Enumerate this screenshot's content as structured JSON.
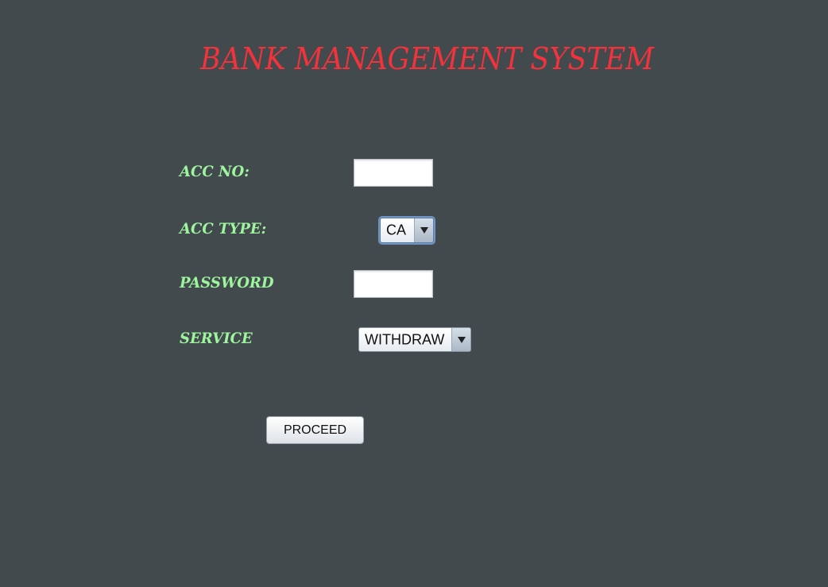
{
  "app": {
    "title": "BANK MANAGEMENT SYSTEM"
  },
  "form": {
    "acc_no": {
      "label": "ACC NO:",
      "value": ""
    },
    "acc_type": {
      "label": "ACC TYPE:",
      "selected": "CA"
    },
    "password": {
      "label": "PASSWORD",
      "value": ""
    },
    "service": {
      "label": "SERVICE",
      "selected": "WITHDRAW"
    },
    "proceed_label": "PROCEED"
  },
  "colors": {
    "background": "#434a4e",
    "title": "#f2333b",
    "labels": "#9df59d"
  },
  "icons": {
    "dropdown": "chevron-down-icon"
  }
}
